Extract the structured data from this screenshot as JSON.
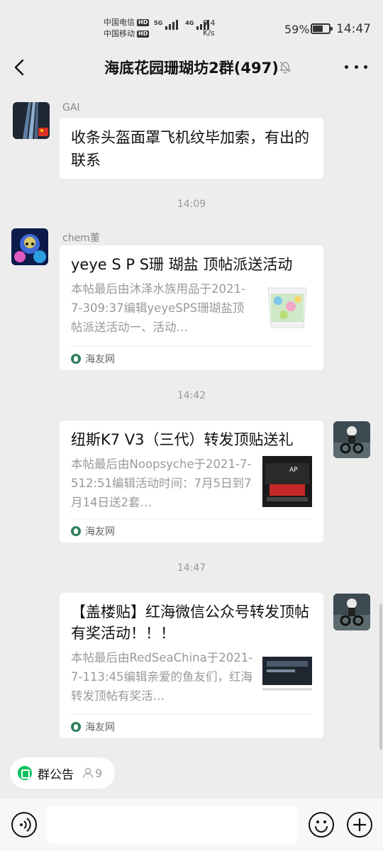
{
  "status_bar": {
    "carrier1": "中国电信",
    "carrier2": "中国移动",
    "hd": "HD",
    "net1": "5G",
    "net2": "4G",
    "speed_value": "9.4",
    "speed_unit": "K/s",
    "battery_pct": "59%",
    "battery_level": 0.59,
    "time": "14:47"
  },
  "header": {
    "title": "海底花园珊瑚坊2群(497)"
  },
  "messages": {
    "m1": {
      "sender": "GAI",
      "text": "收条头盔面罩飞机纹毕加索，有出的联系"
    },
    "t1": "14:09",
    "m2": {
      "sender": "chem董",
      "card_title": "yeye S P S珊 瑚盐 顶帖派送活动",
      "card_desc": "本帖最后由沐泽水族用品于2021-7-309:37编辑yeyeSPS珊瑚盐顶帖派送活动一、活动…",
      "source": "海友网"
    },
    "t2": "14:42",
    "m3": {
      "card_title": "纽斯K7 V3（三代）转发顶贴送礼",
      "card_desc": "本帖最后由Noopsyche于2021-7-512:51编辑活动时间：7月5日到7月14日送2套…",
      "source": "海友网"
    },
    "t3": "14:47",
    "m4": {
      "card_title": "【盖楼贴】红海微信公众号转发顶帖有奖活动！！！",
      "card_desc": "本帖最后由RedSeaChina于2021-7-113:45编辑亲爱的鱼友们，红海转发顶帖有奖活…",
      "source": "海友网"
    }
  },
  "bottom": {
    "notice_label": "群公告",
    "member_count": "9",
    "input_placeholder": ""
  },
  "colors": {
    "accent": "#07c160",
    "background": "#ededed"
  }
}
